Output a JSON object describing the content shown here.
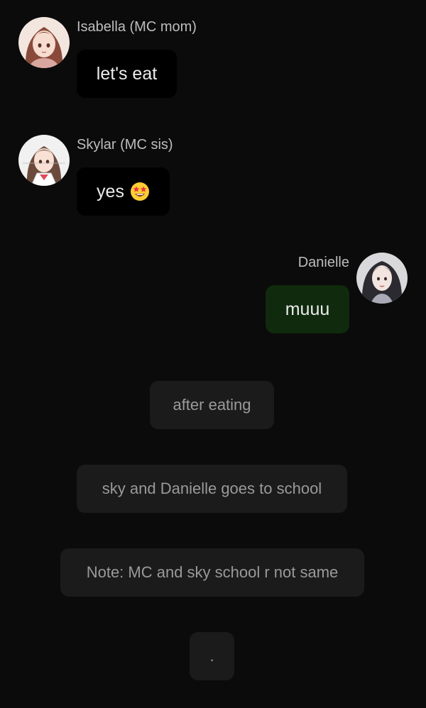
{
  "messages": [
    {
      "sender": "Isabella (MC mom)",
      "text": "let's eat",
      "side": "left",
      "avatar": "isabella-avatar"
    },
    {
      "sender": "Skylar (MC sis)",
      "text": "yes",
      "emoji": "star-struck-emoji",
      "side": "left",
      "avatar": "skylar-avatar"
    },
    {
      "sender": "Danielle",
      "text": "muuu",
      "side": "right",
      "avatar": "danielle-avatar"
    }
  ],
  "narrations": [
    {
      "text": "after eating"
    },
    {
      "text": "sky and Danielle goes to school"
    },
    {
      "text": "Note: MC and sky school r not same"
    },
    {
      "text": "."
    }
  ],
  "colors": {
    "background": "#0b0b0b",
    "left_bubble": "#000000",
    "right_bubble": "#0f2a0d",
    "narration_bubble": "#1b1b1b",
    "sender_text": "#bdbdbd",
    "narration_text": "#9a9a9a"
  }
}
